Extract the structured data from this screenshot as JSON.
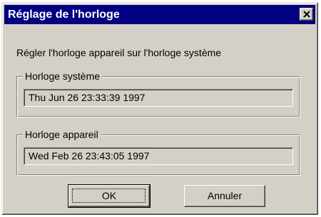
{
  "window": {
    "title": "Réglage de l'horloge",
    "close_icon": "close-icon"
  },
  "instruction": "Régler l'horloge appareil sur l'horloge système",
  "system_clock": {
    "label": "Horloge système",
    "value": "Thu Jun 26 23:33:39 1997"
  },
  "device_clock": {
    "label": "Horloge appareil",
    "value": "Wed Feb 26 23:43:05 1997"
  },
  "buttons": {
    "ok_label": "OK",
    "cancel_label": "Annuler"
  },
  "colors": {
    "titlebar": "#000080",
    "dialog_face": "#d4d0c8"
  }
}
